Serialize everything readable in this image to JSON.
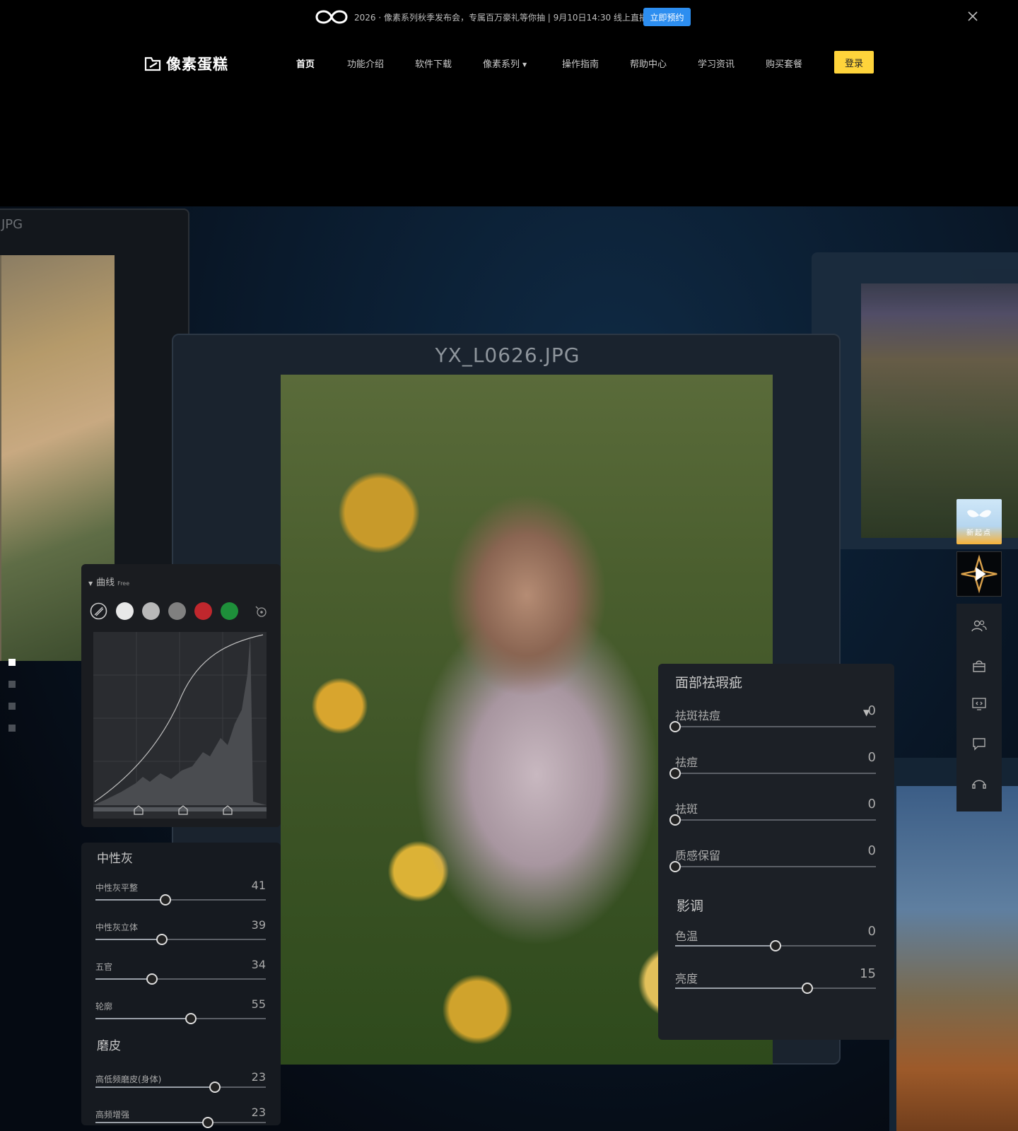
{
  "announcement": {
    "text": "2026 · 像素系列秋季发布会，专属百万豪礼等你抽 | 9月10日14:30 线上直播",
    "cta": "立即预约"
  },
  "header": {
    "brand": "像素蛋糕",
    "nav": [
      "首页",
      "功能介绍",
      "软件下载",
      "像素系列",
      "操作指南",
      "帮助中心",
      "学习资讯",
      "购买套餐"
    ],
    "login": "登录"
  },
  "hero": {
    "back_left_title": "JPG",
    "main_title": "YX_L0626.JPG",
    "curve_panel": {
      "title": "曲线",
      "badge": "Free",
      "swatches": [
        "#e8e8e8",
        "#b8b8b8",
        "#808080",
        "#c0272d",
        "#1e8f3a",
        "#1f4fa8"
      ]
    },
    "gray_panel": {
      "section1": "中性灰",
      "sliders1": [
        {
          "label": "中性灰平整",
          "value": "41",
          "fraction": 0.41
        },
        {
          "label": "中性灰立体",
          "value": "39",
          "fraction": 0.39
        },
        {
          "label": "五官",
          "value": "34",
          "fraction": 0.33
        },
        {
          "label": "轮廓",
          "value": "55",
          "fraction": 0.56
        }
      ],
      "section2": "磨皮",
      "sliders2": [
        {
          "label": "高低频磨皮(身体)",
          "value": "23",
          "fraction": 0.7
        },
        {
          "label": "高频增强",
          "value": "23",
          "fraction": 0.66
        }
      ]
    },
    "beauty_panel": {
      "section1": "面部祛瑕疵",
      "sliders1": [
        {
          "label": "祛斑祛痘",
          "value": "0",
          "fraction": 0
        },
        {
          "label": "祛痘",
          "value": "0",
          "fraction": 0
        },
        {
          "label": "祛斑",
          "value": "0",
          "fraction": 0
        },
        {
          "label": "质感保留",
          "value": "0",
          "fraction": 0
        }
      ],
      "section2": "影调",
      "sliders2": [
        {
          "label": "色温",
          "value": "0",
          "fraction": 0.5
        },
        {
          "label": "亮度",
          "value": "15",
          "fraction": 0.66
        }
      ]
    }
  },
  "floating": {
    "promo": "新起点",
    "tools": [
      "community-icon",
      "shop-icon",
      "video-tutorial-icon",
      "feedback-icon",
      "customer-service-icon"
    ]
  },
  "colors": {
    "accent_yellow": "#ffd43b",
    "accent_blue": "#2d8ef0"
  }
}
